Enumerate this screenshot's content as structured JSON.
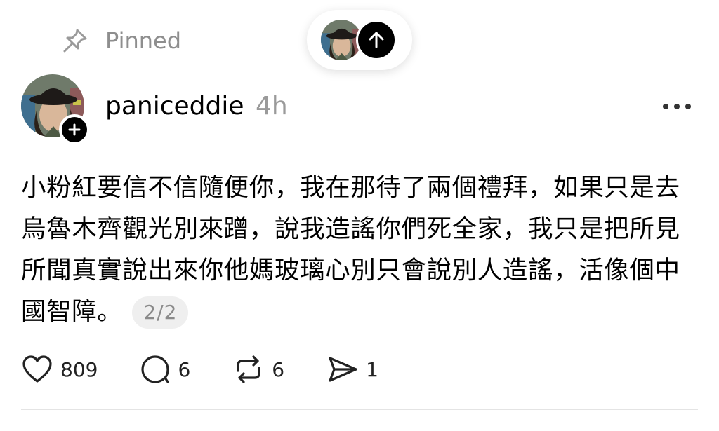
{
  "header": {
    "pinned_icon": "pin-icon",
    "pinned_label": "Pinned",
    "scroll_top_icon": "arrow-up-icon"
  },
  "post": {
    "username": "paniceddie",
    "timestamp": "4h",
    "follow_icon": "plus-icon",
    "more_icon": "more-horizontal-icon",
    "text": "小粉紅要信不信隨便你，我在那待了兩個禮拜，如果只是去烏魯木齊觀光別來蹭，說我造謠你們死全家，我只是把所見所聞真實說出來你他媽玻璃心別只會說別人造謠，活像個中國智障。",
    "thread_position": "2/2"
  },
  "actions": {
    "likes": "809",
    "comments": "6",
    "reposts": "6",
    "shares": "1"
  },
  "colors": {
    "muted_text": "#8e8e8e",
    "badge_bg": "#efefef",
    "icon": "#222222"
  }
}
